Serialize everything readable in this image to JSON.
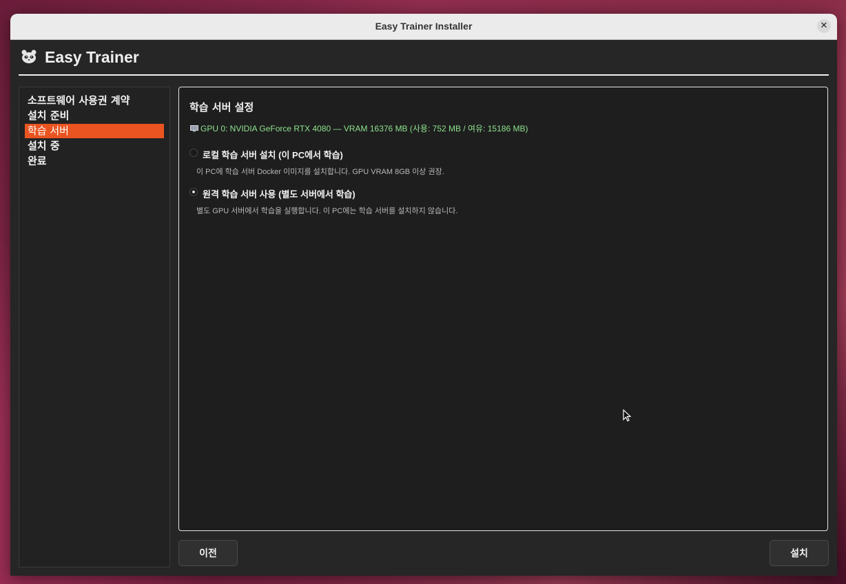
{
  "window": {
    "title": "Easy Trainer Installer",
    "close_glyph": "✕"
  },
  "header": {
    "app_title": "Easy Trainer",
    "logo_icon": "panda-icon"
  },
  "sidebar": {
    "items": [
      {
        "label": "소프트웨어 사용권 계약",
        "active": false
      },
      {
        "label": "설치 준비",
        "active": false
      },
      {
        "label": "학습 서버",
        "active": true
      },
      {
        "label": "설치 중",
        "active": false
      },
      {
        "label": "완료",
        "active": false
      }
    ]
  },
  "main": {
    "section_title": "학습 서버 설정",
    "gpu_info": "GPU 0: NVIDIA GeForce RTX 4080  —  VRAM 16376 MB (사용: 752 MB / 여유: 15186 MB)",
    "options": [
      {
        "label": "로컬 학습 서버 설치 (이 PC에서 학습)",
        "description": "이 PC에 학습 서버 Docker 이미지를 설치합니다. GPU VRAM 8GB 이상 권장.",
        "selected": false
      },
      {
        "label": "원격 학습 서버 사용 (별도 서버에서 학습)",
        "description": "별도 GPU 서버에서 학습을 실행합니다. 이 PC에는 학습 서버를 설치하지 않습니다.",
        "selected": true
      }
    ]
  },
  "footer": {
    "back_label": "이전",
    "install_label": "설치"
  },
  "colors": {
    "accent": "#e95420",
    "gpu_text": "#8fe38f"
  }
}
